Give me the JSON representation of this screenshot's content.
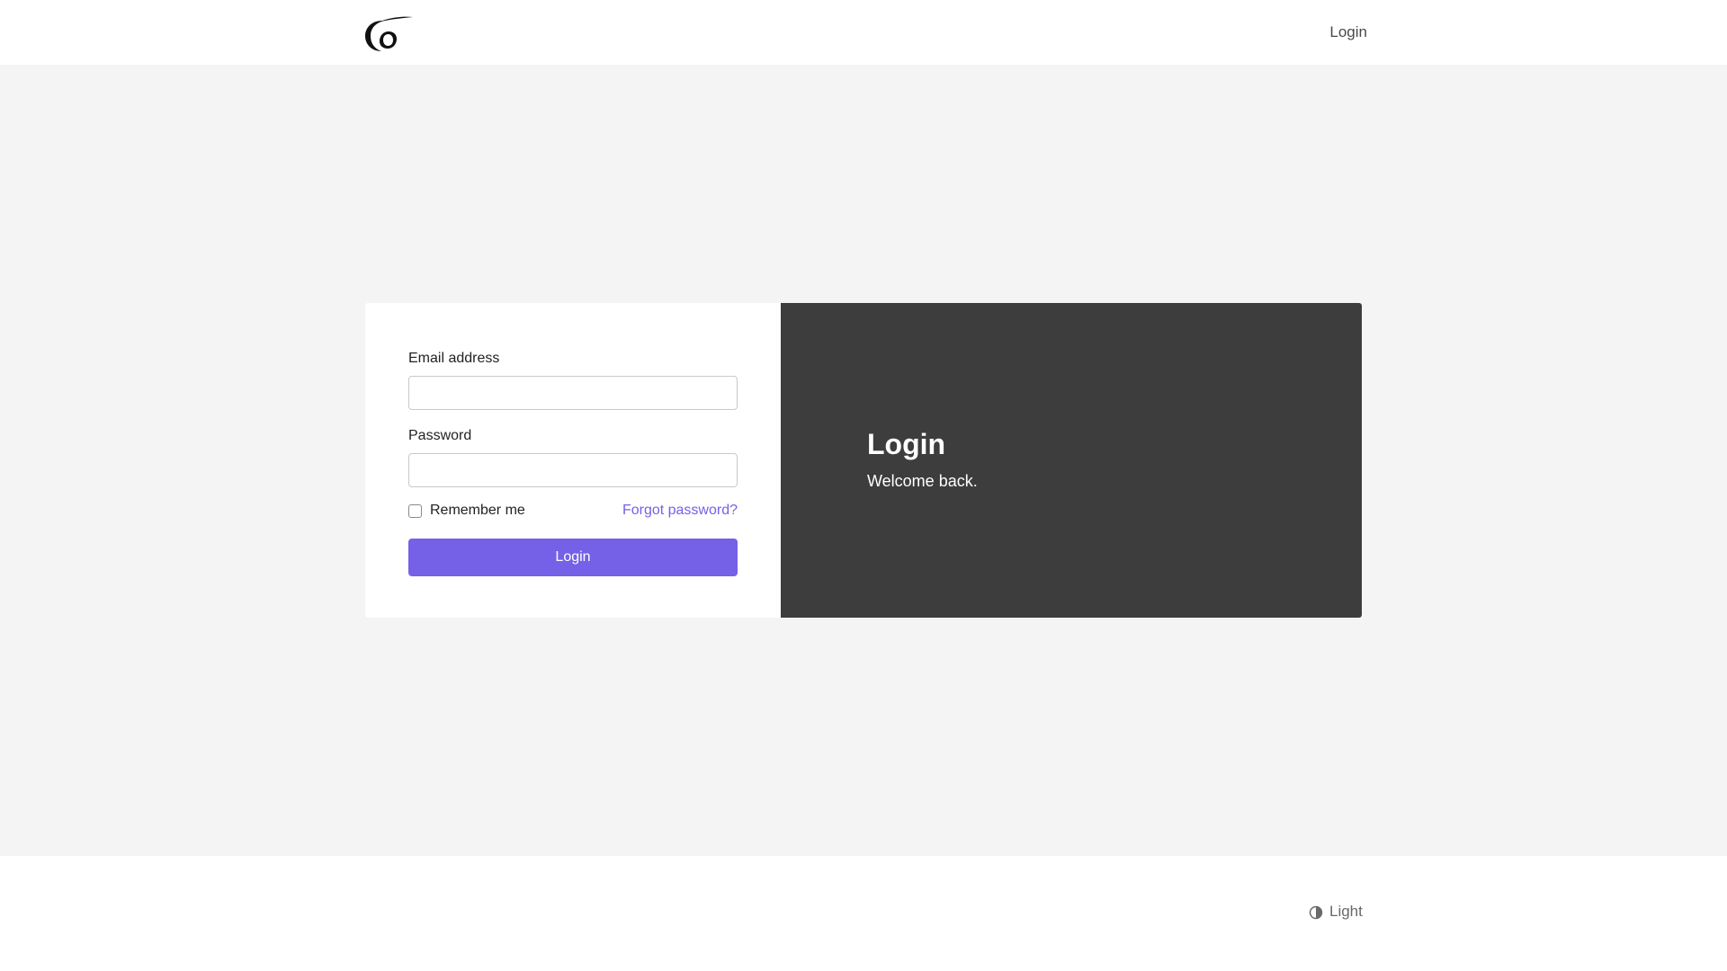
{
  "header": {
    "logo_name": "swirl-logo",
    "nav_login_label": "Login"
  },
  "login_form": {
    "email_label": "Email address",
    "email_value": "",
    "password_label": "Password",
    "password_value": "",
    "remember_label": "Remember me",
    "remember_checked": false,
    "forgot_label": "Forgot password?",
    "submit_label": "Login"
  },
  "info_panel": {
    "title": "Login",
    "subtitle": "Welcome back."
  },
  "footer": {
    "theme_icon": "half-circle-contrast-icon",
    "theme_label": "Light"
  },
  "colors": {
    "accent": "#7560e8",
    "panel_dark": "#3d3d3d",
    "background": "#f4f4f4"
  }
}
